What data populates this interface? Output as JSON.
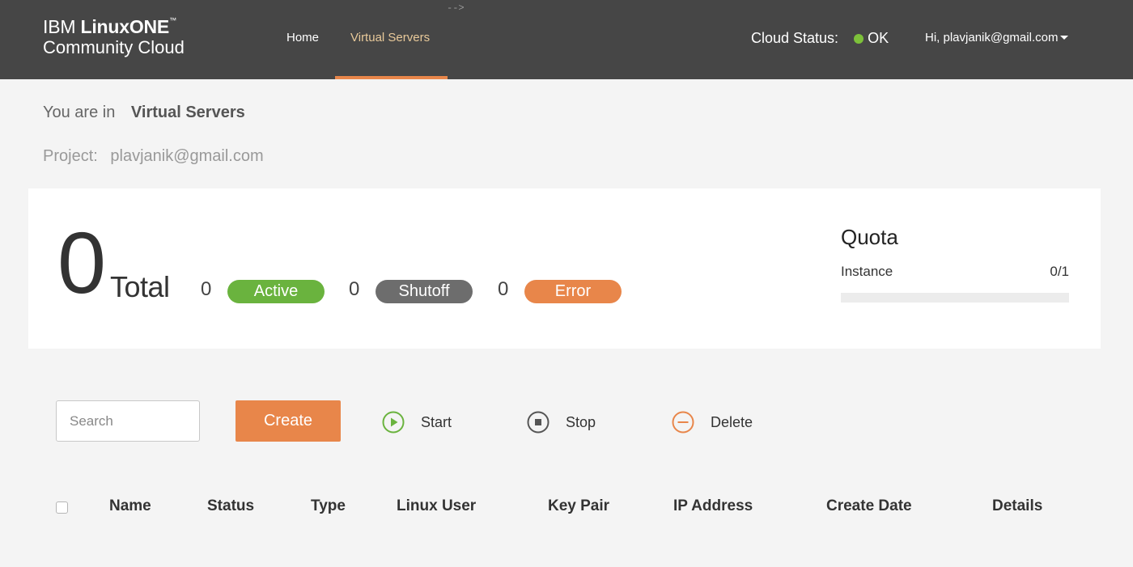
{
  "header": {
    "stray_text": "-->",
    "logo": {
      "brand_light": "IBM ",
      "brand_bold": "LinuxONE",
      "trademark": "™",
      "subtitle": "Community Cloud"
    },
    "nav": [
      {
        "label": "Home",
        "active": false
      },
      {
        "label": "Virtual Servers",
        "active": true
      }
    ],
    "cloud_status": {
      "label": "Cloud Status:",
      "value": "OK",
      "color": "#7dc13a"
    },
    "user_greeting": "Hi, plavjanik@gmail.com",
    "colors": {
      "bar": "#464646",
      "active_nav": "#e8c99a",
      "accent": "#e8864a"
    }
  },
  "breadcrumb": {
    "prefix": "You are in",
    "current": "Virtual Servers"
  },
  "project": {
    "label": "Project:",
    "value": "plavjanik@gmail.com"
  },
  "summary": {
    "total_count": "0",
    "total_label": "Total",
    "statuses": [
      {
        "count": "0",
        "label": "Active",
        "color": "#6ab33e"
      },
      {
        "count": "0",
        "label": "Shutoff",
        "color": "#6d6d6d"
      },
      {
        "count": "0",
        "label": "Error",
        "color": "#e8864a"
      }
    ]
  },
  "quota": {
    "title": "Quota",
    "items": [
      {
        "label": "Instance",
        "value": "0/1",
        "used_fraction": 0
      }
    ]
  },
  "toolbar": {
    "search_placeholder": "Search",
    "create_label": "Create",
    "actions": [
      {
        "label": "Start",
        "icon": "play-circle-icon",
        "color": "#6ab33e"
      },
      {
        "label": "Stop",
        "icon": "stop-circle-icon",
        "color": "#555555"
      },
      {
        "label": "Delete",
        "icon": "minus-circle-icon",
        "color": "#e8864a"
      }
    ]
  },
  "table": {
    "columns": [
      "Name",
      "Status",
      "Type",
      "Linux User",
      "Key Pair",
      "IP Address",
      "Create Date",
      "Details"
    ],
    "rows": []
  }
}
